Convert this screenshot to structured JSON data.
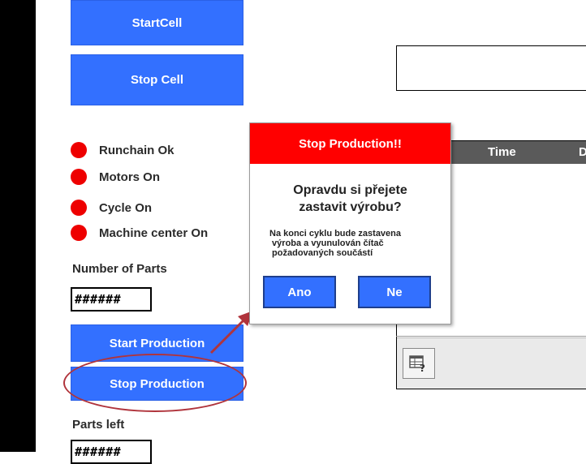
{
  "controls": {
    "start_cell": "StartCell",
    "stop_cell": "Stop Cell",
    "start_production": "Start Production",
    "stop_production": "Stop Production"
  },
  "indicators": [
    {
      "label": "Runchain Ok",
      "color": "#ee0000"
    },
    {
      "label": "Motors On",
      "color": "#ee0000"
    },
    {
      "label": "Cycle On",
      "color": "#ee0000"
    },
    {
      "label": "Machine center On",
      "color": "#ee0000"
    }
  ],
  "number_of_parts": {
    "label": "Number of Parts",
    "value": "######"
  },
  "parts_left": {
    "label": "Parts left",
    "value": "######"
  },
  "table": {
    "columns": [
      "Time",
      "D"
    ]
  },
  "toolbar": {
    "icon": "table-help-icon"
  },
  "dialog": {
    "title": "Stop Production!!",
    "question_line1": "Opravdu si přejete",
    "question_line2": "zastavit výrobu?",
    "note_line1": "Na konci cyklu bude zastavena",
    "note_line2": " výroba a vyunulován čítač",
    "note_line3": " požadovaných součástí",
    "yes": "Ano",
    "no": "Ne"
  },
  "annotation": {
    "highlight_color": "#b0343c"
  },
  "colors": {
    "button": "#3370ff",
    "dialog_title": "#ff0000",
    "led_off": "#ee0000"
  }
}
